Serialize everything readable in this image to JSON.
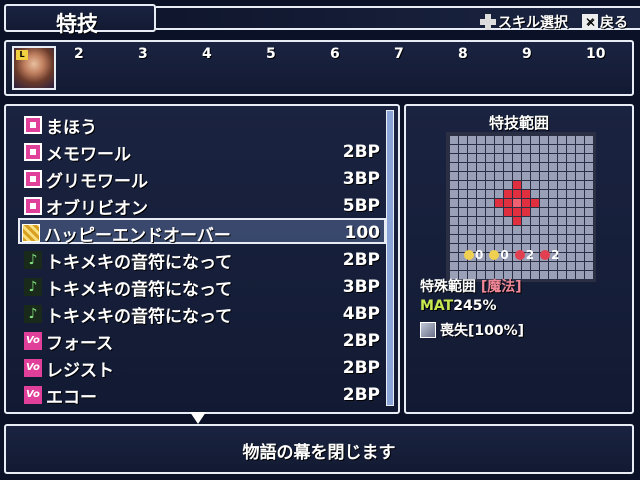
{
  "header": {
    "title": "特技",
    "hint_switch": "スキル選択",
    "hint_back": "戻る"
  },
  "party": {
    "slots": [
      "2",
      "3",
      "4",
      "5",
      "6",
      "7",
      "8",
      "9",
      "10"
    ]
  },
  "list": {
    "category": "まほう",
    "items": [
      {
        "name": "メモワール",
        "cost": "2BP",
        "icon": "magic"
      },
      {
        "name": "グリモワール",
        "cost": "3BP",
        "icon": "magic"
      },
      {
        "name": "オブリビオン",
        "cost": "5BP",
        "icon": "magic"
      },
      {
        "name": "ハッピーエンドオーバー",
        "cost": "100",
        "icon": "gold"
      },
      {
        "name": "トキメキの音符になって",
        "cost": "2BP",
        "icon": "note"
      },
      {
        "name": "トキメキの音符になって",
        "cost": "3BP",
        "icon": "note"
      },
      {
        "name": "トキメキの音符になって",
        "cost": "4BP",
        "icon": "note"
      },
      {
        "name": "フォース",
        "cost": "2BP",
        "icon": "vo"
      },
      {
        "name": "レジスト",
        "cost": "2BP",
        "icon": "vo"
      },
      {
        "name": "エコー",
        "cost": "2BP",
        "icon": "vo"
      }
    ],
    "selected_index": 3
  },
  "detail": {
    "title": "特技範囲",
    "stats": [
      {
        "value": "0",
        "icon": "yellow"
      },
      {
        "value": "0",
        "icon": "yellow"
      },
      {
        "value": "2",
        "icon": "red"
      },
      {
        "value": "2",
        "icon": "red"
      }
    ],
    "range_label": "特殊範囲",
    "range_type": "[魔法]",
    "mat_key": "MAT",
    "mat_value": "245%",
    "loss_text": "喪失[100%]"
  },
  "help": {
    "text": "物語の幕を閉じます"
  },
  "colors": {
    "window_bg": "#1a2340",
    "border": "#e8ecf4",
    "range_red": "#e03040",
    "magic_pink": "#e0409a"
  }
}
